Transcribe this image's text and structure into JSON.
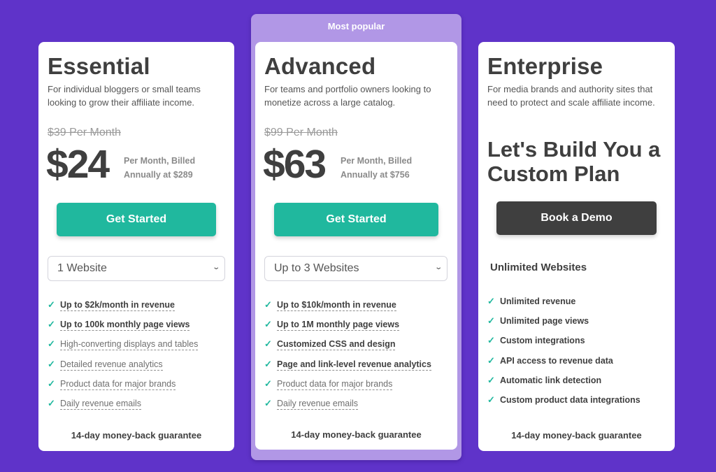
{
  "colors": {
    "background": "#5f33c9",
    "popular_frame": "#b197e6",
    "accent_green": "#20b89e",
    "dark_button": "#3f3f3f",
    "text": "#3f3f3f"
  },
  "plans": [
    {
      "name": "Essential",
      "description": "For individual bloggers or small teams looking to grow their affiliate income.",
      "old_price": "$39 Per Month",
      "price": "$24",
      "billing": "Per Month, Billed Annually at $289",
      "cta_label": "Get Started",
      "select_value": "1 Website",
      "features": [
        {
          "text": "Up to $2k/month in revenue",
          "emphasis": "bold"
        },
        {
          "text": "Up to 100k monthly page views",
          "emphasis": "bold"
        },
        {
          "text": "High-converting displays and tables",
          "emphasis": "light"
        },
        {
          "text": "Detailed revenue analytics",
          "emphasis": "light"
        },
        {
          "text": "Product data for major brands",
          "emphasis": "light"
        },
        {
          "text": "Daily revenue emails",
          "emphasis": "light"
        }
      ],
      "guarantee": "14-day money-back guarantee"
    },
    {
      "badge": "Most popular",
      "name": "Advanced",
      "description": "For teams and portfolio owners looking to monetize across a large catalog.",
      "old_price": "$99 Per Month",
      "price": "$63",
      "billing": "Per Month, Billed Annually at $756",
      "cta_label": "Get Started",
      "select_value": "Up to 3 Websites",
      "features": [
        {
          "text": "Up to $10k/month in revenue",
          "emphasis": "bold"
        },
        {
          "text": "Up to 1M monthly page views",
          "emphasis": "bold"
        },
        {
          "text": "Customized CSS and design",
          "emphasis": "bold"
        },
        {
          "text": "Page and link-level revenue analytics",
          "emphasis": "bold"
        },
        {
          "text": "Product data for major brands",
          "emphasis": "light"
        },
        {
          "text": "Daily revenue emails",
          "emphasis": "light"
        }
      ],
      "guarantee": "14-day money-back guarantee"
    },
    {
      "name": "Enterprise",
      "description": "For media brands and authority sites that need to protect and scale affiliate income.",
      "headline": "Let's Build You a Custom Plan",
      "cta_label": "Book a Demo",
      "websites": "Unlimited Websites",
      "features": [
        {
          "text": "Unlimited revenue",
          "emphasis": "plain"
        },
        {
          "text": "Unlimited page views",
          "emphasis": "plain"
        },
        {
          "text": "Custom integrations",
          "emphasis": "plain"
        },
        {
          "text": "API access to revenue data",
          "emphasis": "plain"
        },
        {
          "text": "Automatic link detection",
          "emphasis": "plain"
        },
        {
          "text": "Custom product data integrations",
          "emphasis": "plain"
        }
      ],
      "guarantee": "14-day money-back guarantee"
    }
  ],
  "icons": {
    "check": "✓",
    "chevron_down": "⌄"
  }
}
